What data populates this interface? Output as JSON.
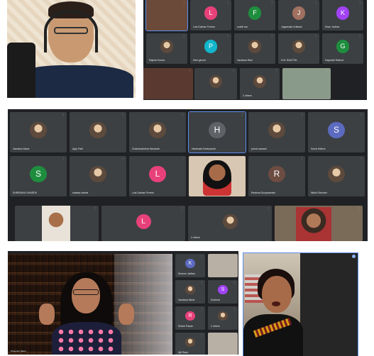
{
  "top_left": {
    "caption": ""
  },
  "top_right": {
    "tiles": [
      {
        "label": "",
        "letter": ""
      },
      {
        "label": "Luis Dalmar Ferrero",
        "letter": "L",
        "color": "#e8417a"
      },
      {
        "label": "sushil rao",
        "letter": "F",
        "color": "#1e8e3e"
      },
      {
        "label": "Jagannath Kulkarni",
        "letter": "J",
        "color": "#a07060"
      },
      {
        "label": "Kiran Jadhav",
        "letter": "K",
        "color": "#a142f4"
      },
      {
        "label": "Rajesh Kumar",
        "letter": "",
        "color": ""
      },
      {
        "label": "Hem ghosh",
        "letter": "P",
        "color": "#12b5cb"
      },
      {
        "label": "Vandana Rani",
        "letter": "",
        "color": ""
      },
      {
        "label": "S.M. BHATTAI",
        "letter": "",
        "color": ""
      },
      {
        "label": "Dayinath Rathod",
        "letter": "G",
        "color": "#1e8e3e"
      },
      {
        "label": "",
        "letter": ""
      },
      {
        "label": "",
        "letter": ""
      },
      {
        "label": "2 others",
        "letter": ""
      },
      {
        "label": "",
        "letter": ""
      }
    ]
  },
  "middle": {
    "tiles": [
      {
        "label": "Vandana Mane",
        "letter": ""
      },
      {
        "label": "Ajay Patil",
        "letter": ""
      },
      {
        "label": "Chandrashekar Navande",
        "letter": ""
      },
      {
        "label": "Harshada Deshpande",
        "letter": "H",
        "color": "#5f6368"
      },
      {
        "label": "pravin sawant",
        "letter": ""
      },
      {
        "label": "Sonia Mishra",
        "letter": "S",
        "color": "#5c6bc0"
      },
      {
        "label": "SHRIRANG KHARDE",
        "letter": "S",
        "color": "#1e8e3e"
      },
      {
        "label": "shweta shinde",
        "letter": ""
      },
      {
        "label": "Luis Dalmar Ferrero",
        "letter": "L",
        "color": "#e8417a"
      },
      {
        "label": "",
        "letter": ""
      },
      {
        "label": "Reshma Suryawanshi",
        "letter": "R",
        "color": "#6d4c41"
      },
      {
        "label": "Nikhil Shendre",
        "letter": ""
      },
      {
        "label": "",
        "letter": ""
      },
      {
        "label": "",
        "letter": "L",
        "color": "#e8417a"
      },
      {
        "label": "2 others",
        "letter": ""
      },
      {
        "label": "",
        "letter": ""
      }
    ]
  },
  "bottom_left": {
    "presenter_caption": "Presenter Name",
    "side_tiles": [
      {
        "label": "Kishore Jadhav",
        "letter": "K",
        "color": "#5c6bc0"
      },
      {
        "label": "",
        "letter": ""
      },
      {
        "label": "Vandana Mane",
        "letter": ""
      },
      {
        "label": "Sushma",
        "letter": "S",
        "color": "#a142f4"
      },
      {
        "label": "Rohini Pawar",
        "letter": "R",
        "color": "#e8417a"
      },
      {
        "label": "2 others",
        "letter": ""
      },
      {
        "label": "Ajit Rane",
        "letter": ""
      },
      {
        "label": "",
        "letter": ""
      }
    ]
  },
  "bottom_right": {
    "caption": ""
  }
}
